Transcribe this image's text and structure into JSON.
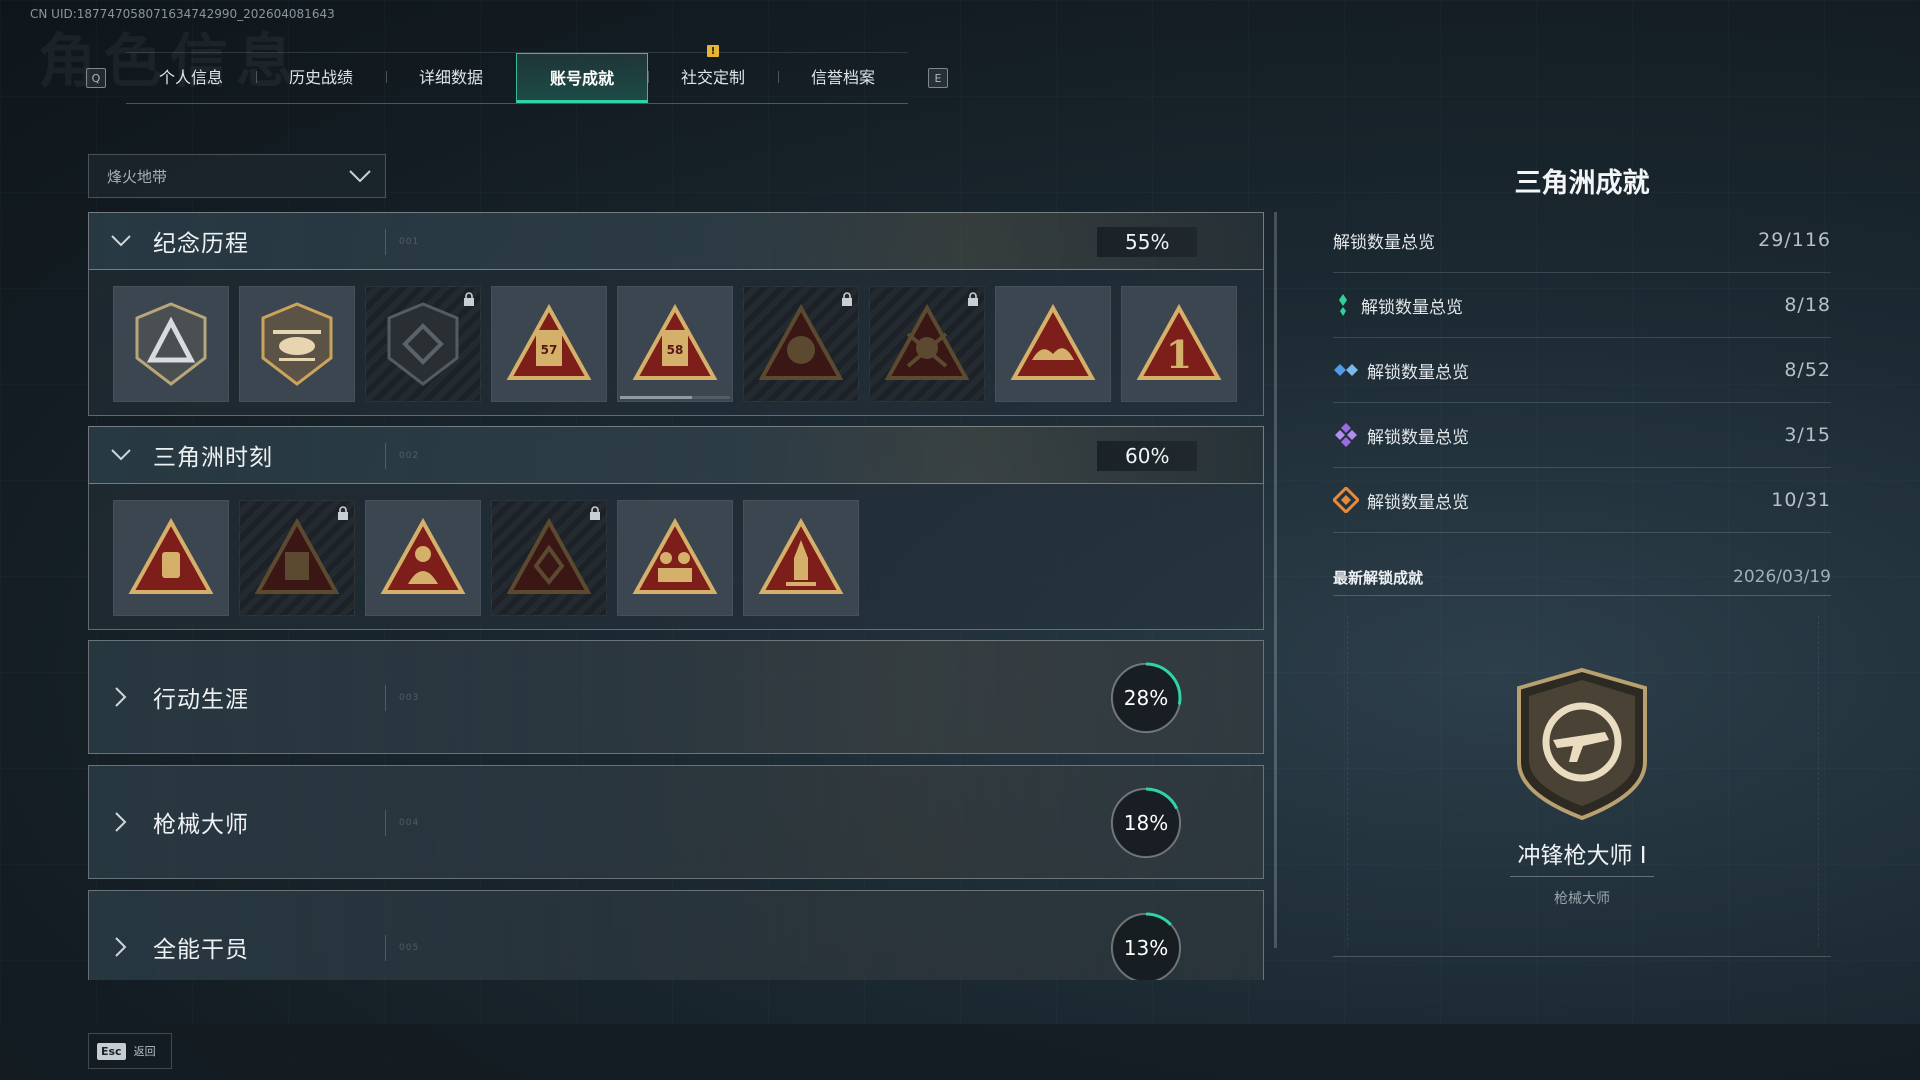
{
  "uid": "CN UID:18774705807163474299​0_202604081643",
  "tabs": {
    "left_key": "Q",
    "right_key": "E",
    "items": [
      {
        "label": "个人信息"
      },
      {
        "label": "历史战绩"
      },
      {
        "label": "详细数据"
      },
      {
        "label": "账号成就",
        "active": true
      },
      {
        "label": "社交定制",
        "alert": "!"
      },
      {
        "label": "信誉档案"
      }
    ]
  },
  "dropdown": {
    "value": "烽火地带"
  },
  "sections": [
    {
      "title": "纪念历程",
      "code": "001",
      "percent": "55%",
      "expanded": true,
      "badges": [
        {
          "icon": "triangle-shield-badge-icon",
          "locked": false
        },
        {
          "icon": "helicopter-badge-icon",
          "locked": false
        },
        {
          "icon": "dark-shield-badge-icon",
          "locked": true
        },
        {
          "icon": "season-57-badge-icon",
          "locked": false
        },
        {
          "icon": "season-58-badge-icon",
          "locked": false,
          "progress": 0.65
        },
        {
          "icon": "operator-badge-icon",
          "locked": true
        },
        {
          "icon": "skull-badge-icon",
          "locked": true
        },
        {
          "icon": "wave-badge-icon",
          "locked": false
        },
        {
          "icon": "rank-one-badge-icon",
          "locked": false
        }
      ]
    },
    {
      "title": "三角洲时刻",
      "code": "002",
      "percent": "60%",
      "expanded": true,
      "badges": [
        {
          "icon": "dogtag-badge-icon",
          "locked": false
        },
        {
          "icon": "armor-badge-icon",
          "locked": true
        },
        {
          "icon": "soldier-badge-icon",
          "locked": false
        },
        {
          "icon": "emblem-badge-icon",
          "locked": true
        },
        {
          "icon": "squad-badge-icon",
          "locked": false
        },
        {
          "icon": "rocket-badge-icon",
          "locked": false
        }
      ]
    },
    {
      "title": "行动生涯",
      "code": "003",
      "percent": "28%",
      "progress": 0.28,
      "expanded": false
    },
    {
      "title": "枪械大师",
      "code": "004",
      "percent": "18%",
      "progress": 0.18,
      "expanded": false
    },
    {
      "title": "全能干员",
      "code": "005",
      "percent": "13%",
      "progress": 0.13,
      "expanded": false
    }
  ],
  "right_panel": {
    "title": "三角洲成就",
    "total": {
      "label": "解锁数量总览",
      "value": "29/116"
    },
    "tiers": [
      {
        "label": "解锁数量总览",
        "value": "8/18",
        "icon": "green-tier-icon",
        "color": "#2fd39a"
      },
      {
        "label": "解锁数量总览",
        "value": "8/52",
        "icon": "blue-tier-icon",
        "color": "#4f9be8"
      },
      {
        "label": "解锁数量总览",
        "value": "3/15",
        "icon": "purple-tier-icon",
        "color": "#9b6be0"
      },
      {
        "label": "解锁数量总览",
        "value": "10/31",
        "icon": "orange-tier-icon",
        "color": "#e88a3c"
      }
    ],
    "recent": {
      "heading": "最新解锁成就",
      "date": "2026/03/19",
      "name": "冲锋枪大师 I",
      "category": "枪械大师"
    }
  },
  "footer": {
    "esc_key": "Esc",
    "esc_label": "返回"
  },
  "colors": {
    "accent": "#2fd3a6",
    "gold": "#c9a45a",
    "badge_red": "#8a1f1c"
  }
}
